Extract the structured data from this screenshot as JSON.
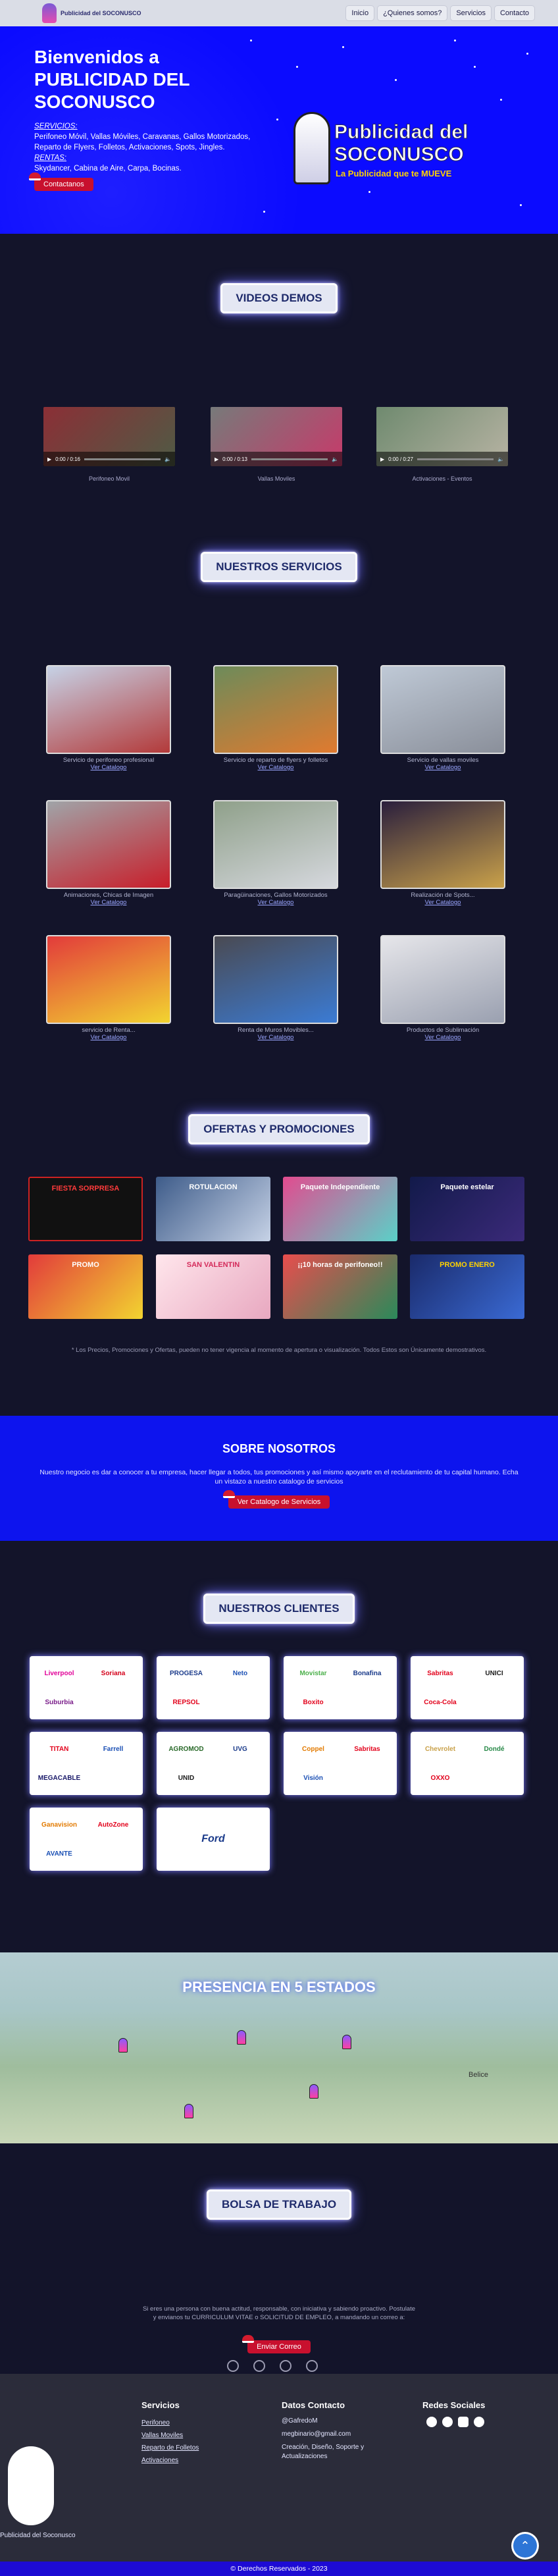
{
  "nav": {
    "logo_text": "Publicidad del SOCONUSCO",
    "links": [
      "Inicio",
      "¿Quienes somos?",
      "Servicios",
      "Contacto"
    ]
  },
  "hero": {
    "title": "Bienvenidos a PUBLICIDAD DEL SOCONUSCO",
    "services_heading": "SERVICIOS:",
    "services_text": "Perifoneo Móvil, Vallas Móviles, Caravanas, Gallos Motorizados, Reparto de Flyers, Folletos, Activaciones, Spots, Jingles.",
    "rentas_heading": "RENTAS:",
    "rentas_text": "Skydancer, Cabina de Aire, Carpa, Bocinas.",
    "cta": "Contactanos",
    "logo_line1": "Publicidad del",
    "logo_line2": "SOCONUSCO",
    "logo_tagline": "La Publicidad que te MUEVE"
  },
  "videos": {
    "title": "VIDEOS DEMOS",
    "items": [
      {
        "time": "0:00 / 0:16",
        "caption": "Perifoneo Movil"
      },
      {
        "time": "0:00 / 0:13",
        "caption": "Vallas Moviles"
      },
      {
        "time": "0:00 / 0:27",
        "caption": "Activaciones - Eventos"
      }
    ]
  },
  "services": {
    "title": "NUESTROS SERVICIOS",
    "link": "Ver Catalogo",
    "items": [
      "Servicio de perifoneo profesional",
      "Servicio de reparto de flyers y folletos",
      "Servicio de vallas moviles",
      "Animaciones, Chicas de Imagen",
      "Paragüinaciones, Gallos Motorizados",
      "Realización de Spots...",
      "servicio de Renta...",
      "Renta de Muros Movibles...",
      "Productos de Sublimación"
    ]
  },
  "promos": {
    "title": "OFERTAS Y PROMOCIONES",
    "note": "* Los Precios, Promociones y Ofertas, pueden no tener vigencia al momento de apertura o visualización. Todos Estos son Únicamente demostrativos.",
    "cards": [
      {
        "text": "FIESTA SORPRESA",
        "color": "#111111"
      },
      {
        "text": "ROTULACION",
        "color": "#3e5c8a"
      },
      {
        "text": "Paquete Independiente",
        "color": "#e24b8f"
      },
      {
        "text": "Paquete estelar",
        "color": "#121a4a"
      },
      {
        "text": "PROMO",
        "color": "#e23b3b"
      },
      {
        "text": "SAN VALENTIN",
        "color": "#ffe6ec"
      },
      {
        "text": "¡¡10 horas de perifoneo!!",
        "color": "#e94d4d"
      },
      {
        "text": "PROMO ENERO",
        "color": "#1a2a6a"
      }
    ]
  },
  "about": {
    "title": "SOBRE NOSOTROS",
    "text": "Nuestro negocio es dar a conocer a tu empresa, hacer llegar a todos, tus promociones y así mismo apoyarte en el reclutamiento de tu capital humano. Echa un vistazo a nuestro catalogo de servicios",
    "cta": "Ver Catalogo de Servicios"
  },
  "clients": {
    "title": "NUESTROS CLIENTES",
    "cards": [
      [
        "Liverpool",
        "Soriana",
        "Suburbia"
      ],
      [
        "PROGESA",
        "Neto",
        "REPSOL"
      ],
      [
        "Movistar",
        "Bonafina",
        "Boxito"
      ],
      [
        "Sabritas",
        "UNICI",
        "Coca-Cola"
      ],
      [
        "TITAN",
        "Farrell",
        "MEGACABLE"
      ],
      [
        "AGROMOD",
        "UVG",
        "UNID"
      ],
      [
        "Coppel",
        "Sabritas",
        "Visión"
      ],
      [
        "Chevrolet",
        "Dondé",
        "OXXO"
      ],
      [
        "Ganavision",
        "AutoZone",
        "AVANTE"
      ],
      [
        "Ford"
      ]
    ]
  },
  "map": {
    "title": "PRESENCIA EN 5 ESTADOS",
    "label": "Belice"
  },
  "jobs": {
    "title": "BOLSA DE TRABAJO",
    "text": "Si eres una persona con buena actitud, responsable, con iniciativa y sabiendo proactivo. Postulate y envianos tu CURRICULUM VITAE o SOLICITUD DE EMPLEO, a mandando un correo a:",
    "cta": "Enviar Correo"
  },
  "footer": {
    "brand": "Publicidad del Soconusco",
    "services_title": "Servicios",
    "services": [
      "Perifoneo",
      "Vallas Moviles",
      "Reparto de Folletos",
      "Activaciones"
    ],
    "contact_title": "Datos Contacto",
    "contact": [
      "@GafredoM",
      "megbinario@gmail.com",
      "Creación, Diseño, Soporte y Actualizaciones"
    ],
    "social_title": "Redes Sociales",
    "copyright": "© Derechos Reservados - 2023"
  }
}
